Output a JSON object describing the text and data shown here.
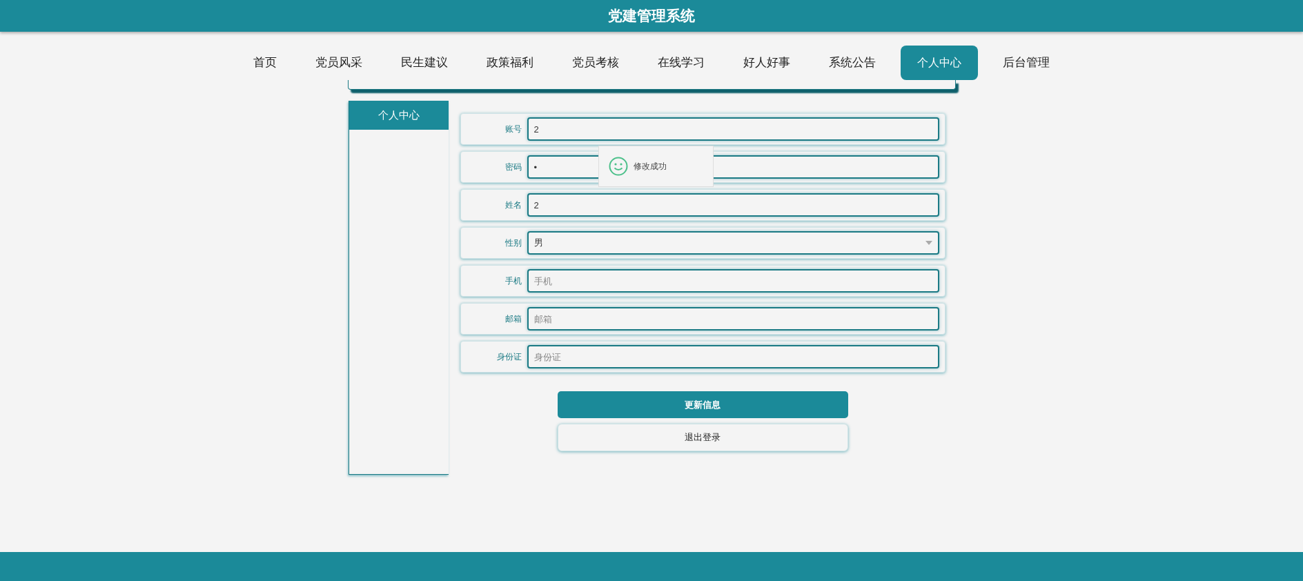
{
  "header": {
    "title": "党建管理系统"
  },
  "nav": [
    {
      "label": "首页",
      "selected": false
    },
    {
      "label": "党员风采",
      "selected": false
    },
    {
      "label": "民生建议",
      "selected": false
    },
    {
      "label": "政策福利",
      "selected": false
    },
    {
      "label": "党员考核",
      "selected": false
    },
    {
      "label": "在线学习",
      "selected": false
    },
    {
      "label": "好人好事",
      "selected": false
    },
    {
      "label": "系统公告",
      "selected": false
    },
    {
      "label": "个人中心",
      "selected": true
    },
    {
      "label": "后台管理",
      "selected": false
    }
  ],
  "sidebar": {
    "title": "个人中心"
  },
  "form": {
    "fields": [
      {
        "label": "账号",
        "kind": "text",
        "value": "2"
      },
      {
        "label": "密码",
        "kind": "text",
        "value": "•"
      },
      {
        "label": "姓名",
        "kind": "text",
        "value": "2"
      },
      {
        "label": "性别",
        "kind": "select",
        "value": "男"
      },
      {
        "label": "手机",
        "kind": "text",
        "placeholder": "手机"
      },
      {
        "label": "邮箱",
        "kind": "text",
        "placeholder": "邮箱"
      },
      {
        "label": "身份证",
        "kind": "text",
        "placeholder": "身份证"
      }
    ],
    "buttons": [
      {
        "label": "更新信息",
        "kind": "primary"
      },
      {
        "label": "退出登录",
        "kind": "secondary"
      }
    ]
  },
  "toast": {
    "message": "修改成功"
  }
}
